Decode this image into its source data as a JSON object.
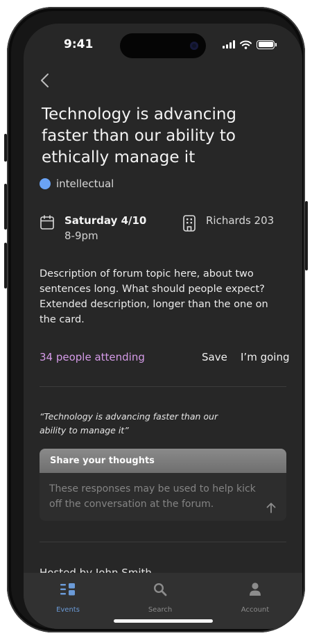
{
  "status_bar": {
    "time": "9:41"
  },
  "event": {
    "title": "Technology is advancing faster than our ability to ethically manage it",
    "tag": {
      "label": "intellectual",
      "color": "#6aa3f5"
    },
    "date": "Saturday 4/10",
    "time_range": "8-9pm",
    "location": "Richards 203",
    "description": "Description of forum topic here, about two sentences long. What should people expect? Extended description, longer than the one on the card.",
    "attending": "34 people attending",
    "save_label": "Save",
    "going_label": "I’m going",
    "quote": "“Technology is advancing faster than our ability to manage it”",
    "share": {
      "header": "Share your thoughts",
      "placeholder": "These responses may be used to help kick off the conversation at the forum."
    },
    "host": "Hosted by John Smith"
  },
  "colors": {
    "accent": "#d59be8",
    "active_tab": "#6b9bd8",
    "background": "#272727"
  },
  "tabs": [
    {
      "label": "Events",
      "icon": "events-icon",
      "active": true
    },
    {
      "label": "Search",
      "icon": "search-icon",
      "active": false
    },
    {
      "label": "Account",
      "icon": "account-icon",
      "active": false
    }
  ]
}
